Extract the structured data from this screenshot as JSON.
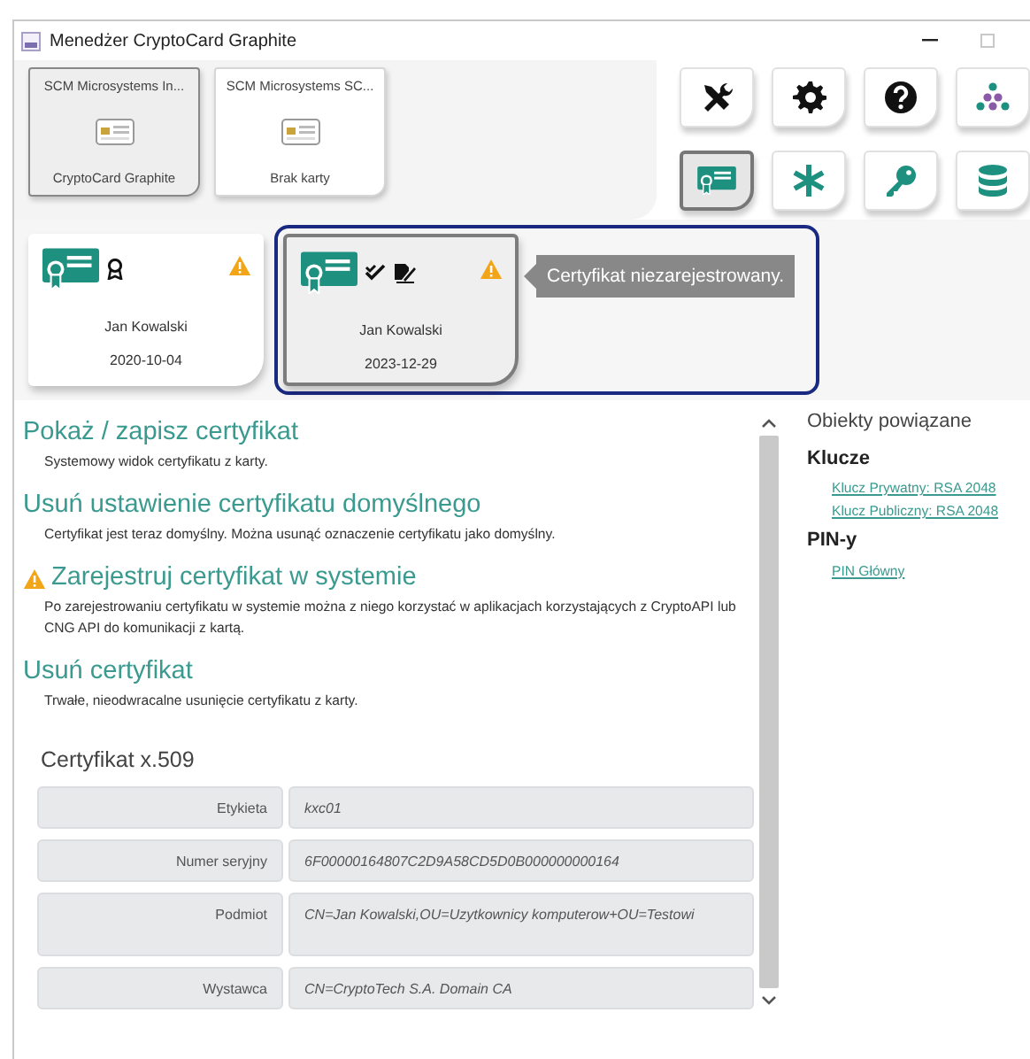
{
  "window": {
    "title": "Menedżer CryptoCard Graphite"
  },
  "readers": [
    {
      "name": "SCM Microsystems In...",
      "card": "CryptoCard Graphite",
      "selected": true
    },
    {
      "name": "SCM Microsystems SC...",
      "card": "Brak karty",
      "selected": false
    }
  ],
  "toolbar": [
    {
      "kind": "tools",
      "selected": false
    },
    {
      "kind": "settings",
      "selected": false
    },
    {
      "kind": "help",
      "selected": false
    },
    {
      "kind": "nodes",
      "selected": false
    },
    {
      "kind": "certificate",
      "selected": true
    },
    {
      "kind": "asterisk",
      "selected": false
    },
    {
      "kind": "key",
      "selected": false
    },
    {
      "kind": "database",
      "selected": false
    }
  ],
  "certificates": [
    {
      "kind": "default",
      "owner": "Jan Kowalski",
      "date": "2020-10-04",
      "warning": true,
      "selected": false
    },
    {
      "kind": "signing",
      "owner": "Jan Kowalski",
      "date": "2023-12-29",
      "warning": true,
      "selected": true,
      "tooltip": "Certyfikat niezarejestrowany."
    }
  ],
  "actions": [
    {
      "title": "Pokaż / zapisz certyfikat",
      "description": "Systemowy widok certyfikatu z karty.",
      "warning": false
    },
    {
      "title": "Usuń ustawienie certyfikatu domyślnego",
      "description": "Certyfikat jest teraz domyślny. Można usunąć oznaczenie certyfikatu jako domyślny.",
      "warning": false
    },
    {
      "title": "Zarejestruj certyfikat w systemie",
      "description": "Po zarejestrowaniu certyfikatu w systemie można z niego korzystać w aplikacjach korzystających z CryptoAPI lub CNG API do komunikacji z kartą.",
      "warning": true
    },
    {
      "title": "Usuń certyfikat",
      "description": "Trwałe, nieodwracalne usunięcie certyfikatu z karty.",
      "warning": false
    }
  ],
  "details": {
    "title": "Certyfikat x.509",
    "rows": [
      {
        "label": "Etykieta",
        "value": "kxc01",
        "tall": false
      },
      {
        "label": "Numer seryjny",
        "value": "6F00000164807C2D9A58CD5D0B000000000164",
        "tall": false
      },
      {
        "label": "Podmiot",
        "value": "CN=Jan Kowalski,OU=Uzytkownicy komputerow+OU=Testowi",
        "tall": true
      },
      {
        "label": "Wystawca",
        "value": "CN=CryptoTech S.A. Domain CA",
        "tall": false
      }
    ]
  },
  "related": {
    "title": "Obiekty powiązane",
    "groups": [
      {
        "title": "Klucze",
        "items": [
          "Klucz Prywatny: RSA 2048",
          "Klucz Publiczny: RSA 2048"
        ]
      },
      {
        "title": "PIN-y",
        "items": [
          "PIN Główny"
        ]
      }
    ]
  }
}
